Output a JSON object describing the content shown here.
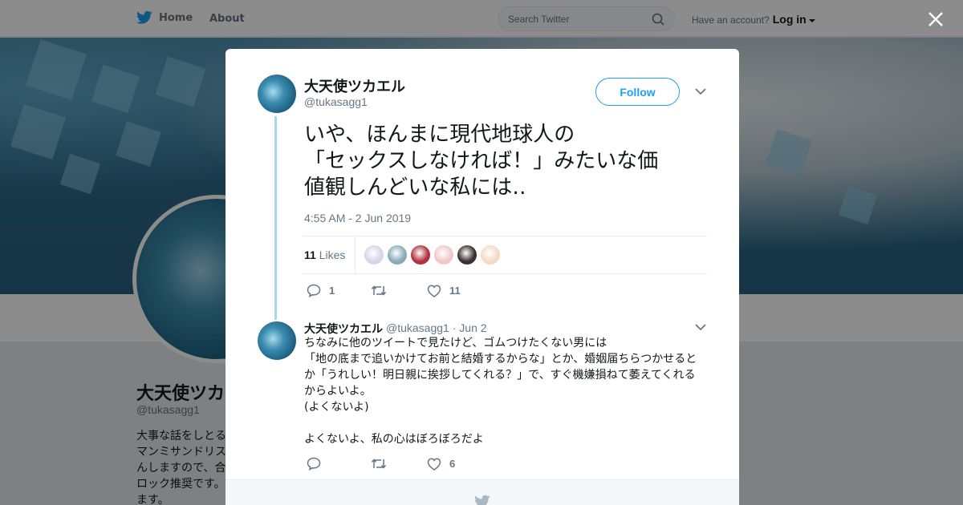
{
  "nav": {
    "home": "Home",
    "about": "About",
    "search_placeholder": "Search Twitter",
    "have_account": "Have an account?",
    "login": "Log in"
  },
  "background_profile": {
    "name": "大天使ツカエ",
    "handle": "@tukasagg1",
    "bio": [
      "大事な話をしとる",
      "マンミサンドリス",
      "んしますので、合",
      "ロック推奨です。",
      "ます。"
    ]
  },
  "tweet": {
    "name": "大天使ツカエル",
    "handle": "@tukasagg1",
    "follow_label": "Follow",
    "text_lines": [
      "いや、ほんまに現代地球人の",
      "「セックスしなければ！」みたいな価",
      "値観しんどいな私には‥"
    ],
    "timestamp": "4:55 AM - 2 Jun 2019",
    "likes_count": "11",
    "likes_label": "Likes",
    "liker_colors": [
      "#d9d3e6",
      "#8aa9b8",
      "#b0323a",
      "#f0c8c8",
      "#3a3030",
      "#f5d9c4"
    ],
    "replies": "1",
    "retweets": "",
    "likes": "11"
  },
  "reply": {
    "name": "大天使ツカエル",
    "handle": "@tukasagg1",
    "date": "Jun 2",
    "text": "ちなみに他のツイートで見たけど、ゴムつけたくない男には\n「地の底まで追いかけてお前と結婚するからな」とか、婚姻届ちらつかせるとか「うれしい！明日親に挨拶してくれる？」で、すぐ機嫌損ねて萎えてくれるからよいよ。\n(よくないよ)\n\nよくないよ、私の心はぼろぼろだよ",
    "replies": "",
    "retweets": "",
    "likes": "6"
  },
  "colors": {
    "accent": "#1da1f2",
    "text": "#14171a",
    "muted": "#657786"
  }
}
